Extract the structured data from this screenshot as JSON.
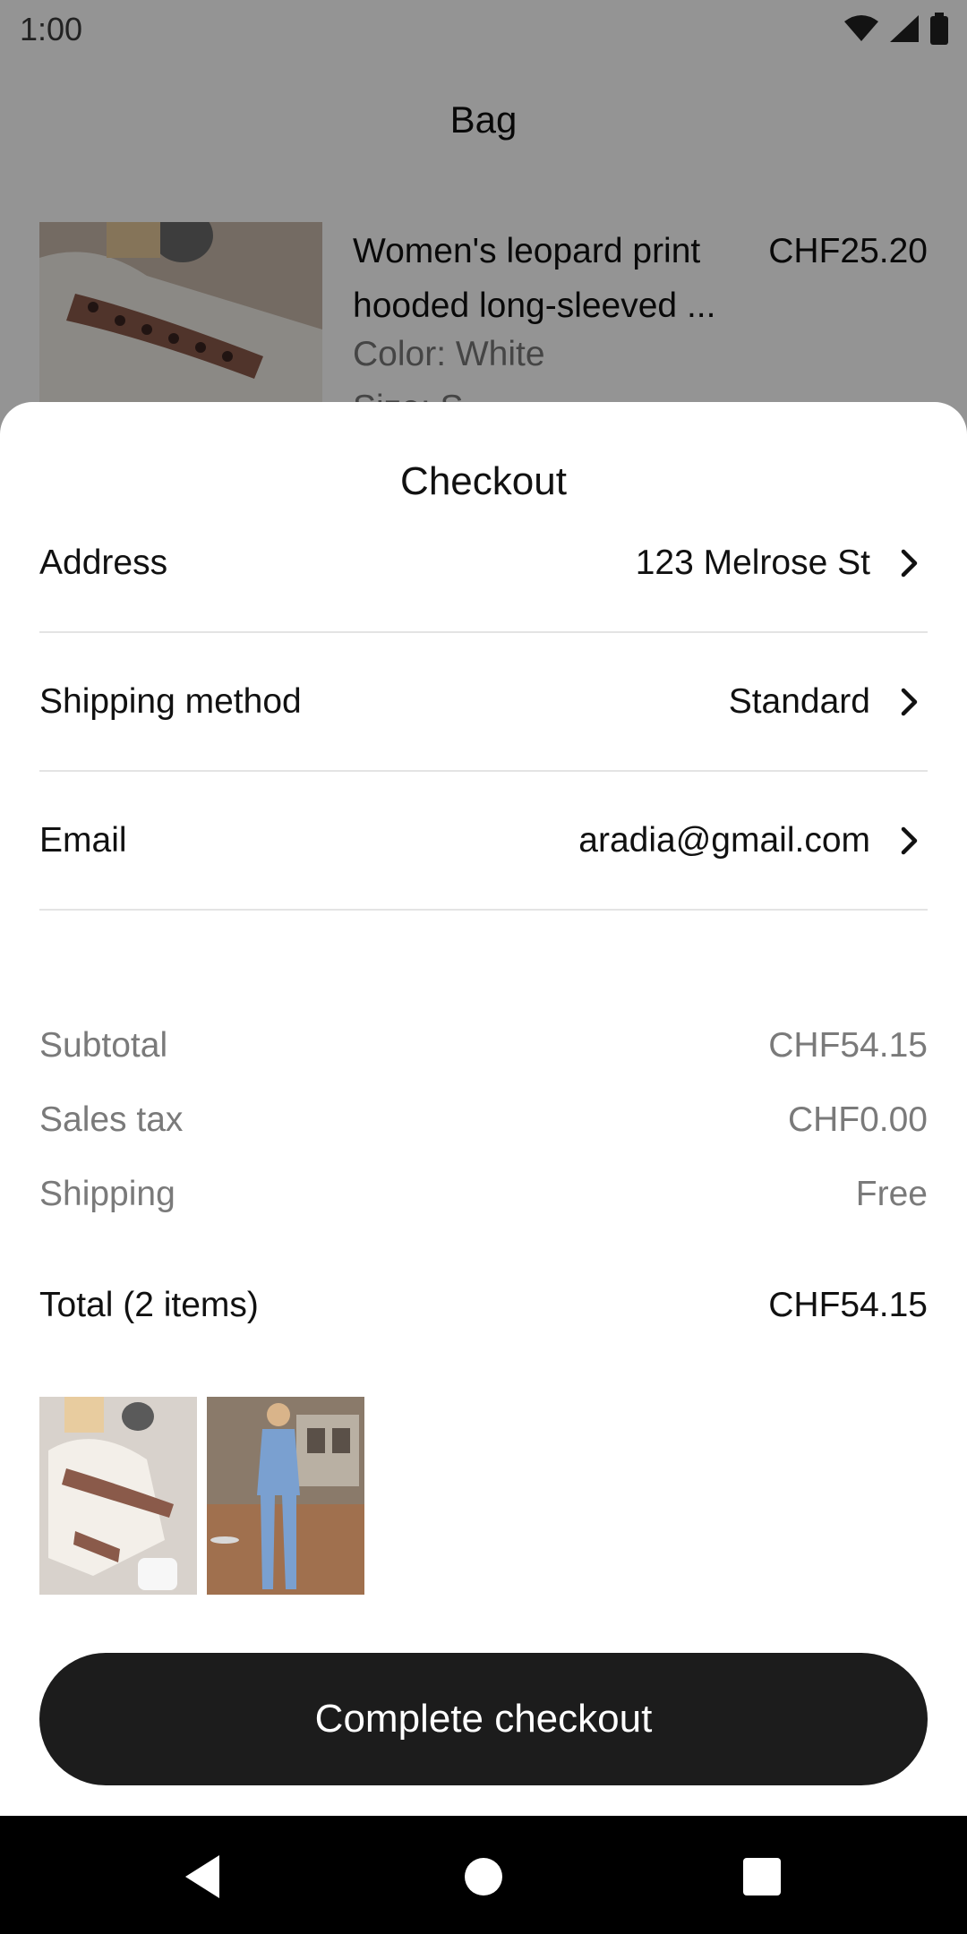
{
  "status_bar": {
    "time": "1:00",
    "icons": [
      "wifi-icon",
      "cell-signal-icon",
      "battery-icon"
    ]
  },
  "bag": {
    "title": "Bag",
    "item": {
      "name": "Women's leopard print hooded long-sleeved ...",
      "color": "Color: White",
      "size": "Size: S",
      "price": "CHF25.20"
    }
  },
  "checkout": {
    "title": "Checkout",
    "rows": [
      {
        "label": "Address",
        "value": "123 Melrose St"
      },
      {
        "label": "Shipping method",
        "value": "Standard"
      },
      {
        "label": "Email",
        "value": "aradia@gmail.com"
      }
    ],
    "summary": [
      {
        "label": "Subtotal",
        "value": "CHF54.15"
      },
      {
        "label": "Sales tax",
        "value": "CHF0.00"
      },
      {
        "label": "Shipping",
        "value": "Free"
      }
    ],
    "total": {
      "label": "Total (2 items)",
      "value": "CHF54.15"
    },
    "cta": "Complete checkout"
  },
  "nav": [
    "back-icon",
    "home-icon",
    "recents-icon"
  ],
  "colors": {
    "button": "#1c1c1c",
    "muted_text": "#7a7a7a",
    "divider": "#e4e4e4"
  }
}
